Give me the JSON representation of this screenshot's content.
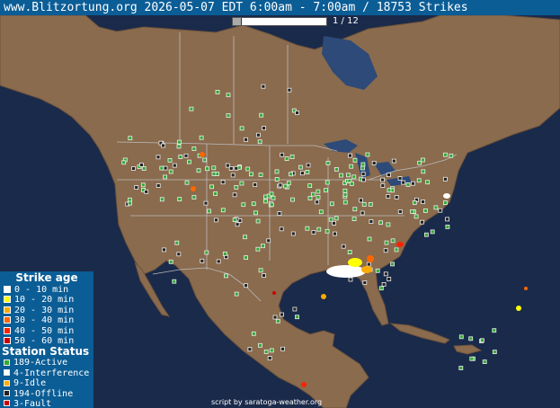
{
  "header": {
    "title": "www.Blitzortung.org 2026-05-07 EDT 6:00am - 7:00am / 18753 Strikes"
  },
  "animation": {
    "frame_counter": "1 / 12",
    "progress": 0.0833
  },
  "legend": {
    "strike_age_title": "Strike age",
    "strike_ages": [
      {
        "label": "0 - 10 min",
        "color": "#ffffff"
      },
      {
        "label": "10 - 20 min",
        "color": "#ffff00"
      },
      {
        "label": "20 - 30 min",
        "color": "#ffaa00"
      },
      {
        "label": "30 - 40 min",
        "color": "#ff6600"
      },
      {
        "label": "40 - 50 min",
        "color": "#ff2200"
      },
      {
        "label": "50 - 60 min",
        "color": "#cc0000"
      }
    ],
    "station_status_title": "Station Status",
    "station_statuses": [
      {
        "label": "189-Active",
        "color": "#33aa33"
      },
      {
        "label": "4-Interference",
        "color": "#ffffff"
      },
      {
        "label": "9-Idle",
        "color": "#ffaa00"
      },
      {
        "label": "194-Offline",
        "color": "#222222"
      },
      {
        "label": "3-Fault",
        "color": "#cc0000"
      }
    ]
  },
  "credit": "script by saratoga-weather.org",
  "colors": {
    "ocean": "#1a2a4a",
    "land": "#8a6b4e",
    "border": "#bbbbbb",
    "title_bg": "#0b5d96"
  }
}
